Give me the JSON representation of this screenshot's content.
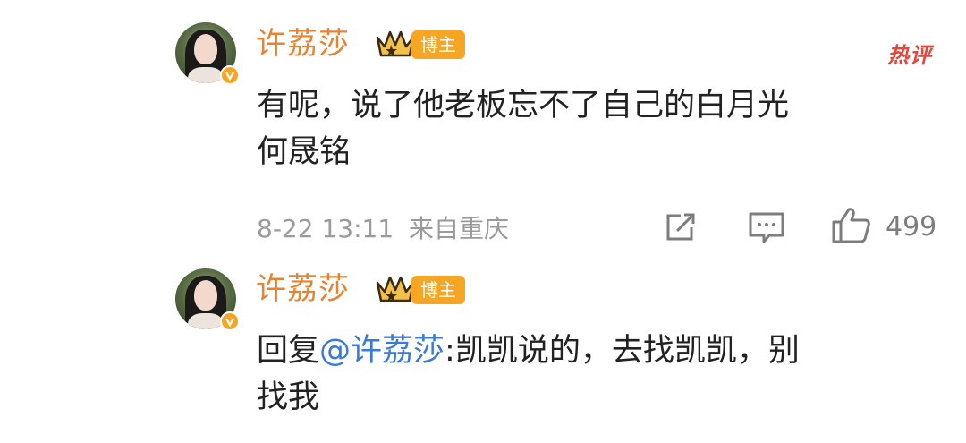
{
  "comments": [
    {
      "username": "许荔莎",
      "badge": "博主",
      "hot_tag": "热评",
      "content_lines": [
        "有呢，说了他老板忘不了自己的白月光",
        "何晟铭"
      ],
      "time": "8-22 13:11",
      "location": "来自重庆",
      "likes": "499"
    },
    {
      "username": "许荔莎",
      "badge": "博主",
      "reply_prefix": "回复",
      "mention": "@许荔莎",
      "content_rest": ":凯凯说的，去找凯凯，别",
      "content_line2": "找我"
    }
  ],
  "icons": {
    "share": "share-icon",
    "comment": "comment-icon",
    "like": "thumbs-up-icon",
    "crown": "crown-icon",
    "verified": "verified-v-icon"
  },
  "colors": {
    "username": "#e8832f",
    "badge": "#f6a623",
    "hot_tag": "#e6453a",
    "mention": "#3a7bd5",
    "meta": "#9a9a9a"
  }
}
